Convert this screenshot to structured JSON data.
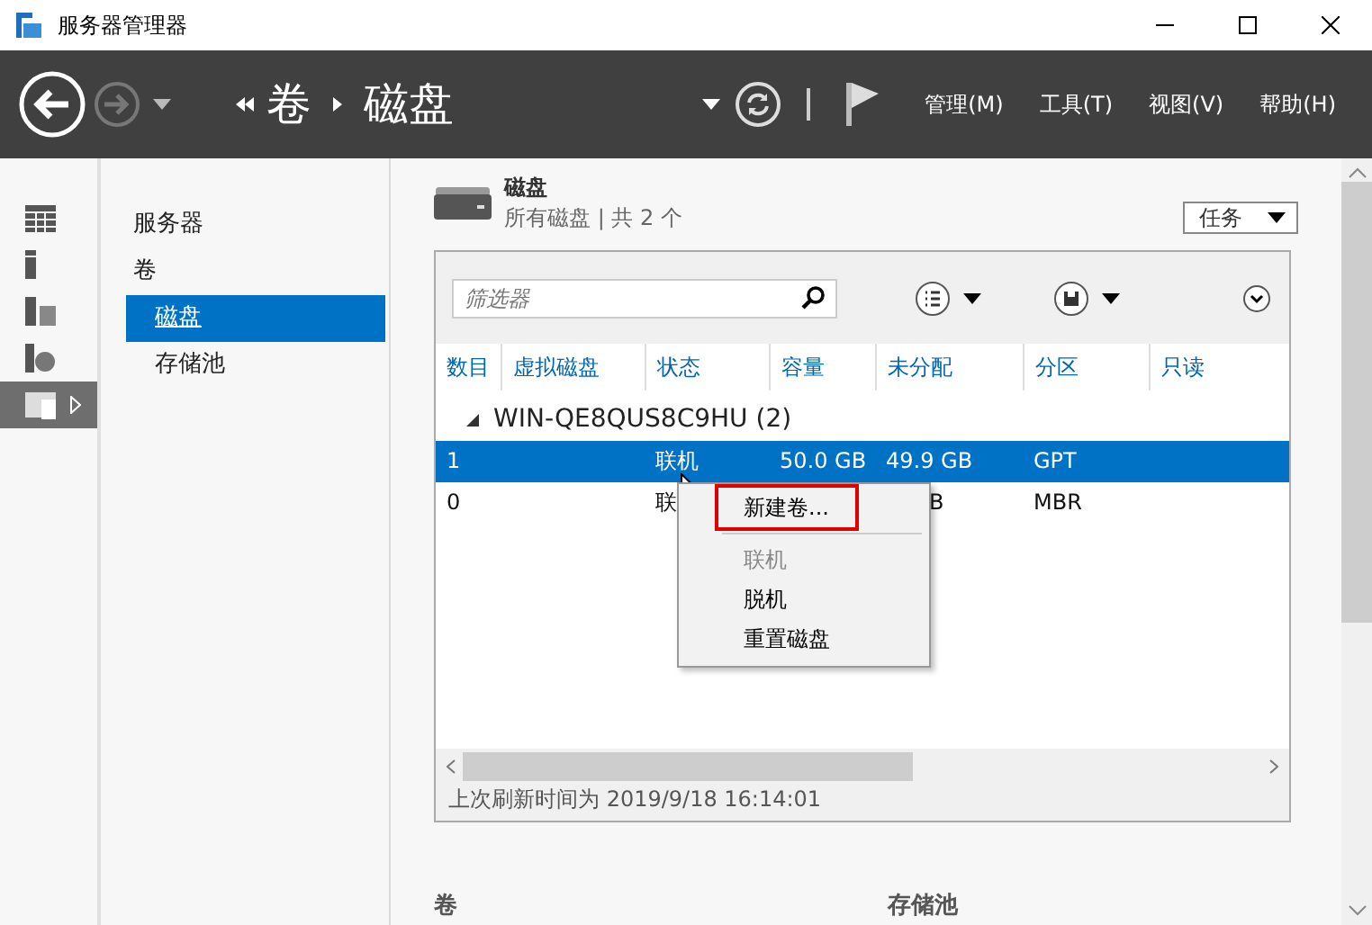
{
  "window": {
    "title": "服务器管理器"
  },
  "toolbar": {
    "breadcrumb": [
      {
        "label": "卷"
      },
      {
        "label": "磁盘"
      }
    ],
    "menus": [
      {
        "label": "管理(M)"
      },
      {
        "label": "工具(T)"
      },
      {
        "label": "视图(V)"
      },
      {
        "label": "帮助(H)"
      }
    ]
  },
  "rail": {
    "items": [
      {
        "kind": "dashboard",
        "selected": false
      },
      {
        "kind": "local-server",
        "selected": false
      },
      {
        "kind": "all-servers",
        "selected": false
      },
      {
        "kind": "iis",
        "selected": false
      },
      {
        "kind": "file-services",
        "selected": true
      }
    ]
  },
  "nav": {
    "items": [
      {
        "label": "服务器",
        "selected": false
      },
      {
        "label": "卷",
        "selected": false,
        "children": [
          {
            "label": "磁盘",
            "selected": true
          },
          {
            "label": "存储池",
            "selected": false
          }
        ]
      }
    ]
  },
  "section": {
    "title": "磁盘",
    "subtitle": "所有磁盘 | 共 2 个",
    "tasks_button": "任务"
  },
  "filter": {
    "placeholder": "筛选器"
  },
  "table": {
    "columns": [
      {
        "label": "数目"
      },
      {
        "label": "虚拟磁盘"
      },
      {
        "label": "状态"
      },
      {
        "label": "容量"
      },
      {
        "label": "未分配"
      },
      {
        "label": "分区"
      },
      {
        "label": "只读"
      }
    ],
    "group": {
      "label": "WIN-QE8QUS8C9HU (2)",
      "expanded": true
    },
    "rows": [
      {
        "selected": true,
        "cells": [
          "1",
          null,
          "联机",
          "50.0 GB",
          "49.9 GB",
          "GPT",
          null
        ]
      },
      {
        "selected": false,
        "cells": [
          "0",
          null,
          "联",
          null,
          "B",
          "MBR",
          null
        ]
      }
    ],
    "footer": "上次刷新时间为 2019/9/18 16:14:01"
  },
  "context_menu": {
    "items": [
      {
        "kind": "item",
        "label": "新建卷...",
        "disabled": false,
        "focused": true
      },
      {
        "kind": "separator"
      },
      {
        "kind": "item",
        "label": "联机",
        "disabled": true,
        "focused": false
      },
      {
        "kind": "item",
        "label": "脱机",
        "disabled": false,
        "focused": false
      },
      {
        "kind": "item",
        "label": "重置磁盘",
        "disabled": false,
        "focused": false
      }
    ]
  },
  "bottom_sections": [
    {
      "title": "卷"
    },
    {
      "title": "存储池"
    }
  ]
}
